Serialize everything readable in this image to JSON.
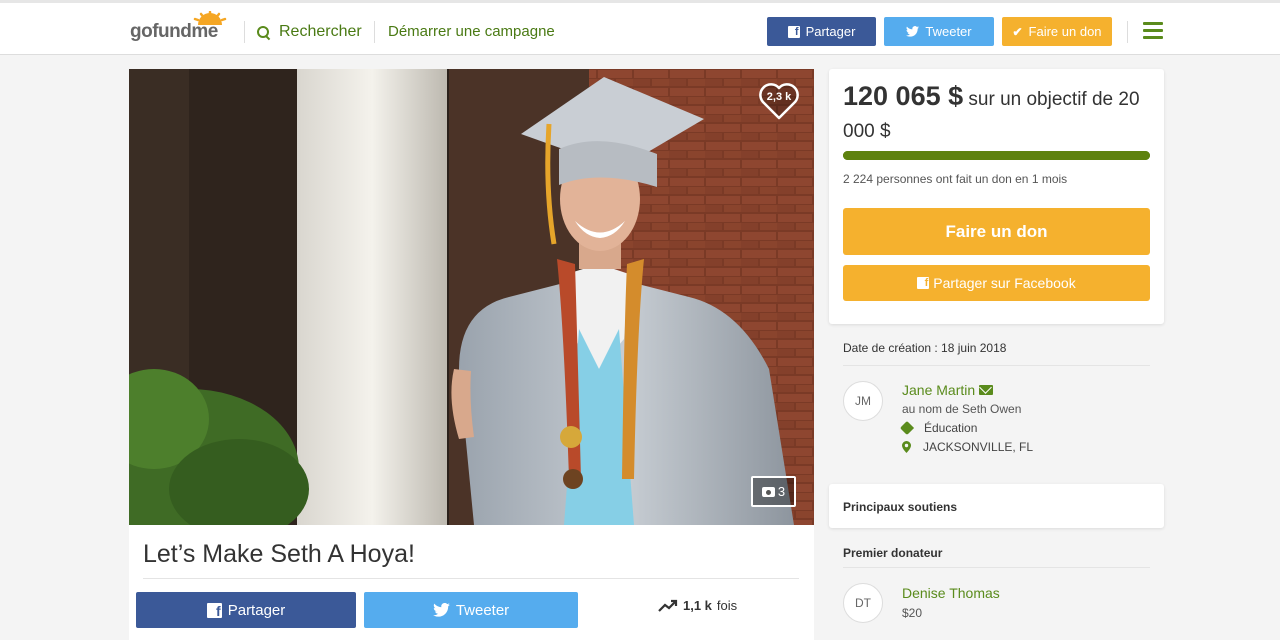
{
  "header": {
    "logo": "gofundme",
    "search_label": "Rechercher",
    "start_label": "Démarrer une campagne",
    "share_label": "Partager",
    "tweet_label": "Tweeter",
    "donate_label": "Faire un don"
  },
  "campaign": {
    "title": "Let’s Make Seth A Hoya!",
    "likes": "2,3 k",
    "photo_count": "3",
    "share_label": "Partager",
    "tweet_label": "Tweeter",
    "shares_count": "1,1 k",
    "shares_suffix": "fois"
  },
  "donation": {
    "raised": "120 065 $",
    "goal_text": "sur un objectif de 20 000 $",
    "progress": 1.0,
    "donors_text": "2 224 personnes ont fait un don en 1 mois",
    "donate_button": "Faire un don",
    "share_facebook": "Partager sur Facebook"
  },
  "details": {
    "created": "Date de création : 18 juin 2018",
    "organizer_initials": "JM",
    "organizer_name": "Jane Martin",
    "on_behalf": "au nom de Seth Owen",
    "category": "Éducation",
    "location": "JACKSONVILLE, FL"
  },
  "supporters": {
    "top_title": "Principaux soutiens",
    "first_title": "Premier donateur",
    "donor_initials": "DT",
    "donor_name": "Denise Thomas",
    "donor_amount": "$20"
  },
  "colors": {
    "brand_green": "#5a8b1c",
    "facebook": "#3b5998",
    "twitter": "#55acee",
    "donate_orange": "#f5b12e"
  }
}
